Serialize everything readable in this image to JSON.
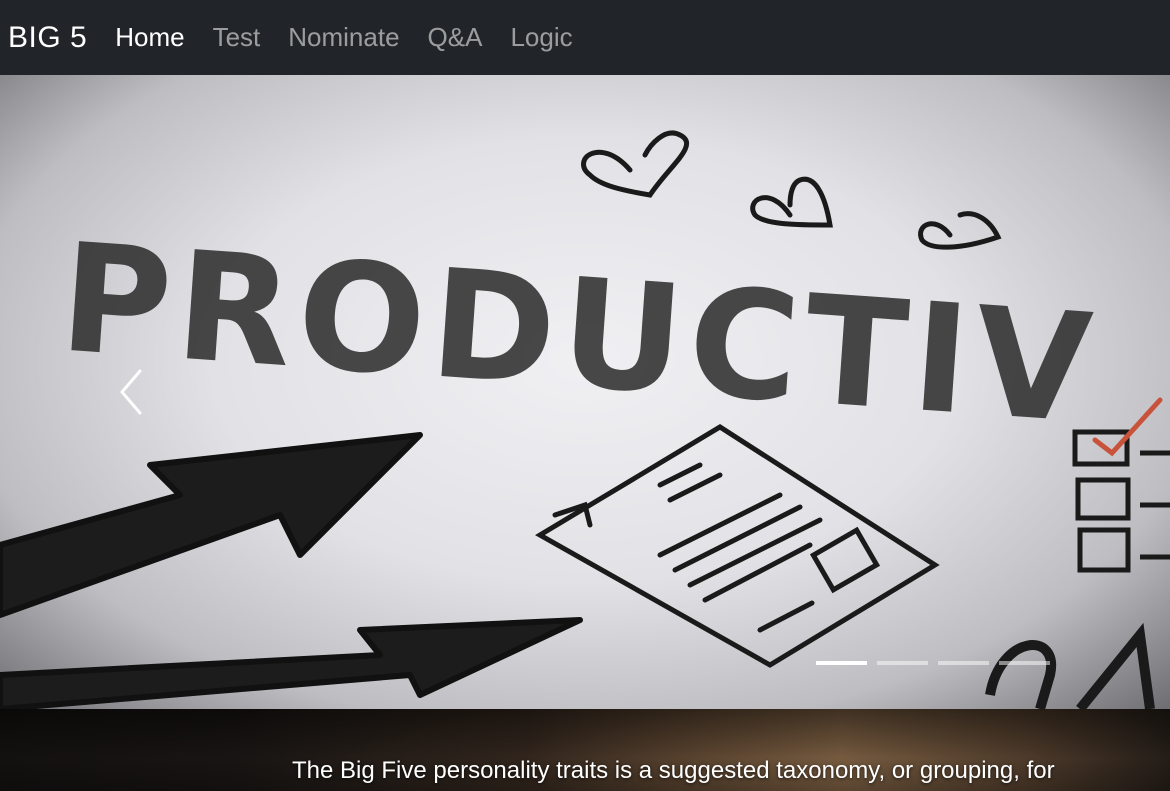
{
  "navbar": {
    "brand": "BIG 5",
    "links": [
      {
        "label": "Home",
        "active": true
      },
      {
        "label": "Test",
        "active": false
      },
      {
        "label": "Nominate",
        "active": false
      },
      {
        "label": "Q&A",
        "active": false
      },
      {
        "label": "Logic",
        "active": false
      }
    ]
  },
  "carousel": {
    "slide_text": "PRODUCTIV",
    "prev_icon": "chevron-left-icon",
    "indicator_count": 4,
    "active_indicator": 1
  },
  "intro": {
    "text": "The Big Five personality traits is a suggested taxonomy, or grouping, for"
  },
  "colors": {
    "navbar_bg": "#212529",
    "active_link": "#ffffff",
    "inactive_link": "rgba(255,255,255,0.55)",
    "check_red": "#c8533a"
  }
}
